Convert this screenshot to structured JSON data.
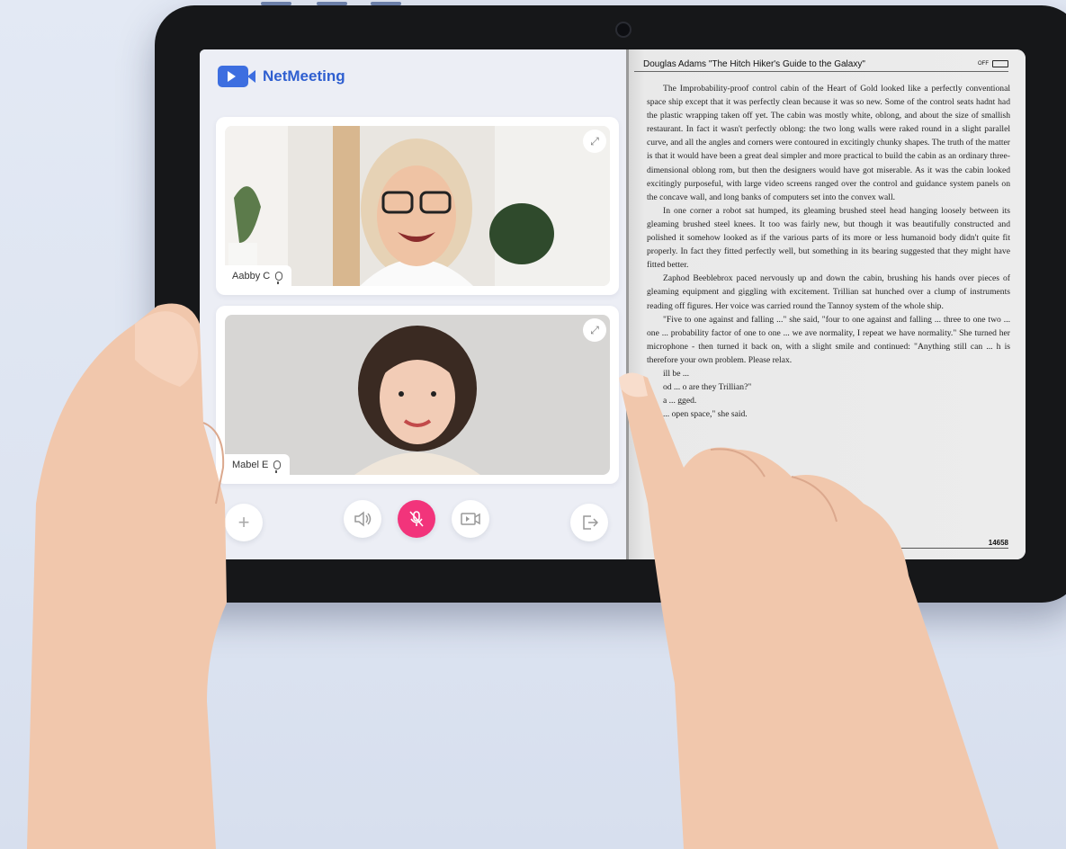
{
  "app": {
    "name": "NetMeeting",
    "participants": [
      {
        "name": "Aabby C"
      },
      {
        "name": "Mabel E"
      }
    ],
    "controls": {
      "add": "add-icon",
      "speaker": "speaker-icon",
      "mute": "mic-off-icon",
      "share": "screen-share-icon",
      "leave": "leave-icon"
    },
    "colors": {
      "accent": "#3d6ee0",
      "mute": "#f2347b"
    }
  },
  "reader": {
    "header": "Douglas Adams \"The Hitch Hiker's Guide to the Galaxy\"",
    "battery_label": "OFF",
    "paragraphs": [
      "The Improbability-proof control cabin of the Heart of Gold looked like a perfectly conventional space ship except that it was perfectly clean because it was so new. Some of the control seats hadnt had the plastic wrapping taken off yet. The cabin was mostly white, oblong, and about the size of smallish restaurant. In fact it wasn't perfectly oblong: the two long walls were raked round in a slight parallel curve, and all the angles and corners were contoured in excitingly chunky shapes. The truth of the matter is that it would have been a great deal simpler and more practical to build the cabin as an ordinary three-dimensional oblong rom, but then the designers would have got miserable. As it was the cabin looked excitingly purposeful, with large video screens ranged over the control and guidance system panels on the concave wall, and long banks of computers set into the convex wall.",
      "In one corner a robot sat humped, its gleaming brushed steel head hanging loosely between its gleaming brushed steel knees. It too was fairly new, but though it was beautifully constructed and polished it somehow looked as if the various parts of its more or less humanoid body didn't quite fit properly. In fact they fitted perfectly well, but something in its bearing suggested that they might have fitted better.",
      "Zaphod Beeblebrox paced nervously up and down the cabin, brushing his hands over pieces of gleaming equipment and giggling with excitement. Trillian sat hunched over a clump of instruments reading off figures. Her voice was carried round the Tannoy system of the whole ship.",
      "\"Five to one against and falling ...\" she said, \"four to one against and falling ... three to one two ... one ... probability factor of one to one ... we ave normality, I repeat we have normality.\" She turned her microphone - then turned it back on, with a slight smile and continued: \"Anything still can ... h is therefore your own problem. Please relax.",
      "ill be ...",
      "od ... o are they Trillian?\"",
      "a ... gged.",
      "... open space,\" she said."
    ],
    "page_number": "14658"
  }
}
